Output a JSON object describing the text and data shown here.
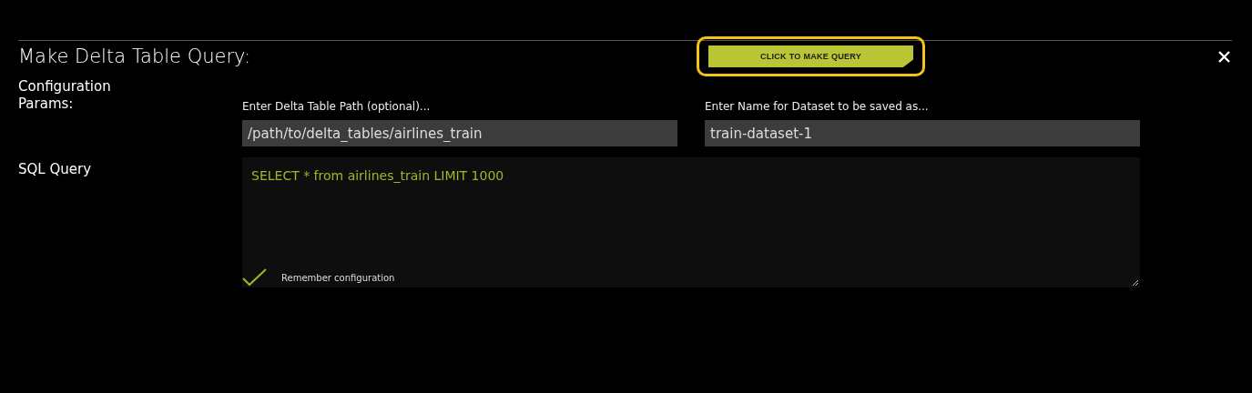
{
  "dialog": {
    "title": "Make Delta Table Query:",
    "action_button": {
      "label": "CLICK TO MAKE QUERY",
      "highlighted": true
    },
    "sections": [
      "Configuration Params:",
      "SQL Query"
    ],
    "fields": [
      {
        "label": "Enter Delta Table Path (optional)...",
        "value": "/path/to/delta_tables/airlines_train"
      },
      {
        "label": "Enter Name for Dataset to be saved as...",
        "value": "train-dataset-1"
      }
    ],
    "query": {
      "value": "SELECT * from airlines_train LIMIT 1000"
    },
    "remember": {
      "label": "Remember configuration",
      "checked": true
    }
  }
}
